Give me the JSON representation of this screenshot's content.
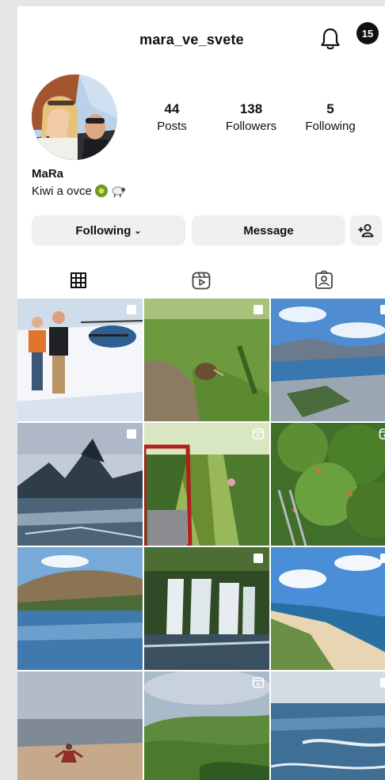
{
  "profile": {
    "username": "mara_ve_svete",
    "notification_count": "15",
    "name": "MaRa",
    "bio": "Kiwi a ovce",
    "stats": [
      {
        "value": "44",
        "label": "Posts"
      },
      {
        "value": "138",
        "label": "Followers"
      },
      {
        "value": "5",
        "label": "Following"
      }
    ]
  },
  "actions": {
    "following_label": "Following",
    "message_label": "Message"
  },
  "tabs": [
    {
      "icon": "grid-icon",
      "active": true
    },
    {
      "icon": "reels-icon",
      "active": false
    },
    {
      "icon": "tagged-icon",
      "active": false
    }
  ],
  "posts": [
    {
      "scene": "helicopter-snow",
      "type": "carousel"
    },
    {
      "scene": "kiwi-bird-grass",
      "type": "carousel"
    },
    {
      "scene": "queenstown-lake",
      "type": "carousel"
    },
    {
      "scene": "milford-sound",
      "type": "carousel"
    },
    {
      "scene": "orchard-car",
      "type": "reel"
    },
    {
      "scene": "peach-trees",
      "type": "reel"
    },
    {
      "scene": "lake-hills",
      "type": "none"
    },
    {
      "scene": "waterfall",
      "type": "carousel"
    },
    {
      "scene": "coast-beach",
      "type": "carousel"
    },
    {
      "scene": "beach-person",
      "type": "none"
    },
    {
      "scene": "green-hills",
      "type": "reel"
    },
    {
      "scene": "ocean-waves",
      "type": "carousel"
    }
  ]
}
